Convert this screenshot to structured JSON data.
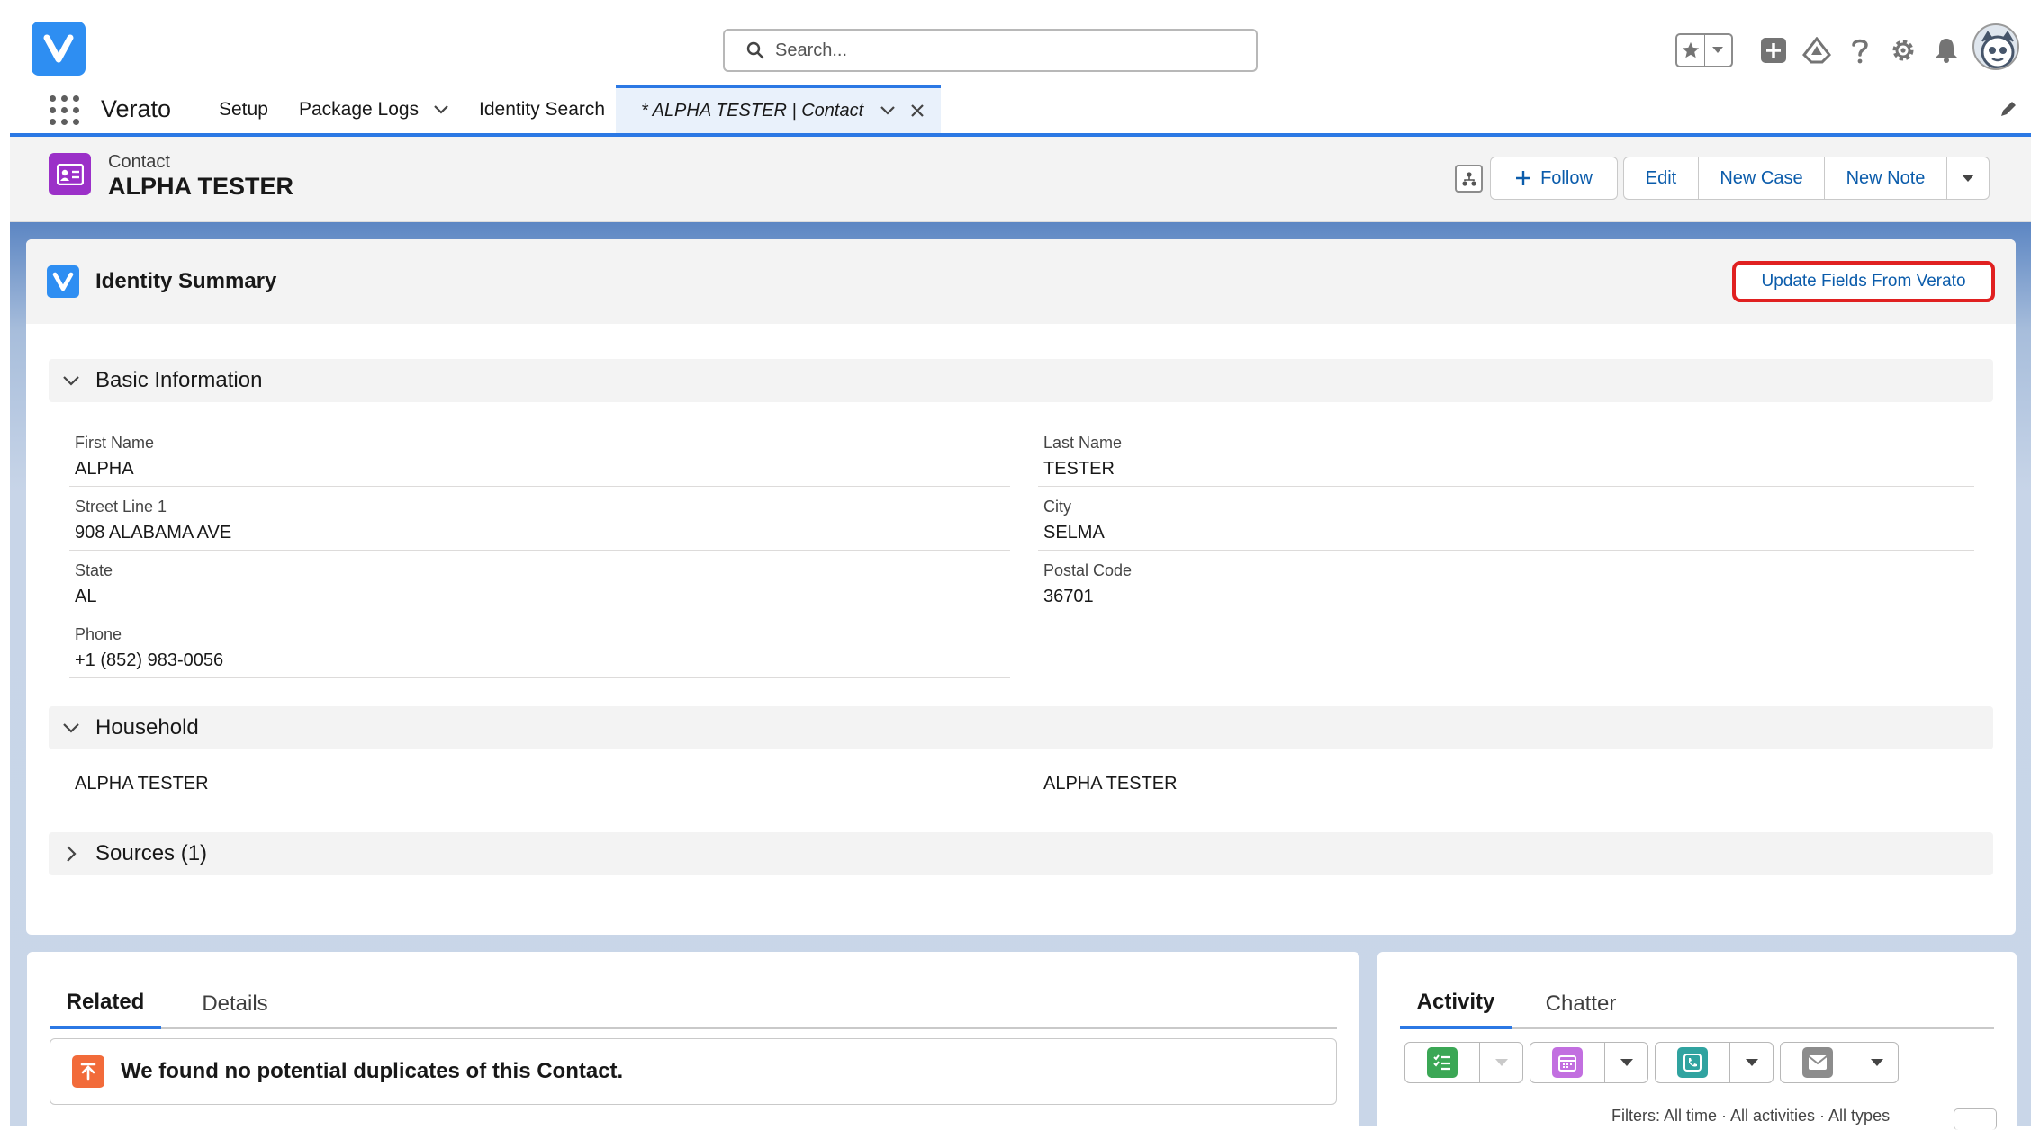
{
  "header": {
    "search_placeholder": "Search...",
    "icons": [
      "favorites-star-icon",
      "favorites-dropdown-icon",
      "global-add-icon",
      "trailhead-icon",
      "help-icon",
      "setup-gear-icon",
      "notifications-bell-icon",
      "user-avatar"
    ]
  },
  "nav": {
    "app_name": "Verato",
    "items": [
      {
        "label": "Setup"
      },
      {
        "label": "Package Logs"
      },
      {
        "label": "Identity Search"
      }
    ],
    "active_tab": "* ALPHA TESTER | Contact"
  },
  "record": {
    "type": "Contact",
    "name": "ALPHA TESTER",
    "buttons": {
      "follow": "Follow",
      "edit": "Edit",
      "new_case": "New Case",
      "new_note": "New Note"
    }
  },
  "identity_summary": {
    "title": "Identity Summary",
    "update_button": "Update Fields From Verato",
    "basic_info": {
      "title": "Basic Information",
      "fields": [
        {
          "label": "First Name",
          "value": "ALPHA"
        },
        {
          "label": "Last Name",
          "value": "TESTER"
        },
        {
          "label": "Street Line 1",
          "value": "908 ALABAMA AVE"
        },
        {
          "label": "City",
          "value": "SELMA"
        },
        {
          "label": "State",
          "value": "AL"
        },
        {
          "label": "Postal Code",
          "value": "36701"
        },
        {
          "label": "Phone",
          "value": "+1 (852) 983-0056"
        }
      ]
    },
    "household": {
      "title": "Household",
      "members": [
        "ALPHA TESTER",
        "ALPHA TESTER"
      ]
    },
    "sources": {
      "title": "Sources (1)"
    }
  },
  "related": {
    "tabs": [
      "Related",
      "Details"
    ],
    "duplicates_message": "We found no potential duplicates of this Contact."
  },
  "activity": {
    "tabs": [
      "Activity",
      "Chatter"
    ],
    "filters_text": "Filters: All time · All activities · All types",
    "colors": {
      "task": "#3ba755",
      "event": "#c26fe0",
      "call": "#30a3a0",
      "email": "#8c8c8c"
    }
  },
  "colors": {
    "brand_blue": "#2e8ef2",
    "link_blue": "#0b5cab",
    "highlight_red": "#e02020",
    "contact_purple": "#9b30c8"
  }
}
